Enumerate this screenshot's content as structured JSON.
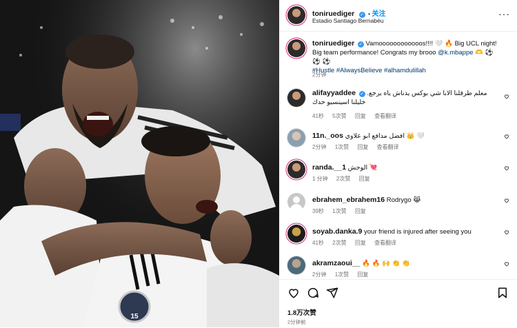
{
  "post": {
    "username": "toniruediger",
    "location": "Estadio Santiago Bernabéu",
    "follow_label": "关注",
    "more_glyph": "···",
    "caption_text_1": "Vamoooooooooooos!!!! 🤍 🔥 Big UCL night! Big team performance! Congrats my brooo",
    "caption_mention": "@k.mbappe",
    "caption_text_2": "🫶 ⚽ ⚽ ⚽",
    "caption_hashtags": "#Hustle #AlwaysBelieve #alhamdulillah",
    "caption_time": "2分钟",
    "photo_badge": "15"
  },
  "comments": [
    {
      "user": "alifayyaddee",
      "verified": true,
      "text": "معلم طرقلنا الابا شي بوكس يدناش ياه يرجع. خليلنا اسينسيو حدك",
      "time": "41秒",
      "likes": "5次赞",
      "reply": "回复",
      "translate": "查看翻译"
    },
    {
      "user": "11n._oos",
      "verified": false,
      "text": "🤍 👑 افضل مدافع ابو علاوي",
      "time": "2分钟",
      "likes": "1次赞",
      "reply": "回复",
      "translate": "查看翻译"
    },
    {
      "user": "randa.__1",
      "verified": false,
      "text": "💘 الوحش",
      "time": "1 分钟",
      "likes": "2次赞",
      "reply": "回复",
      "translate": ""
    },
    {
      "user": "ebrahem_ebrahem16",
      "verified": false,
      "text": "Rodrygo 😹",
      "time": "39秒",
      "likes": "1次赞",
      "reply": "回复",
      "translate": ""
    },
    {
      "user": "soyab.danka.9",
      "verified": false,
      "text": "your friend is injured after seeing you",
      "time": "41秒",
      "likes": "2次赞",
      "reply": "回复",
      "translate": "查看翻译"
    },
    {
      "user": "akramzaoui__",
      "verified": false,
      "text": "🔥 🔥 🙌 👏 👏",
      "time": "2分钟",
      "likes": "1次赞",
      "reply": "回复",
      "translate": ""
    }
  ],
  "footer": {
    "likes": "1.8万次赞",
    "time_ago": "2分钟前"
  },
  "icons": [
    "heart-icon",
    "comment-icon",
    "share-icon",
    "bookmark-icon",
    "more-options-icon",
    "verified-badge-icon"
  ],
  "colors": {
    "link": "#00376b",
    "follow": "#0095f6",
    "verified": "#3797f0",
    "muted": "#737373"
  }
}
